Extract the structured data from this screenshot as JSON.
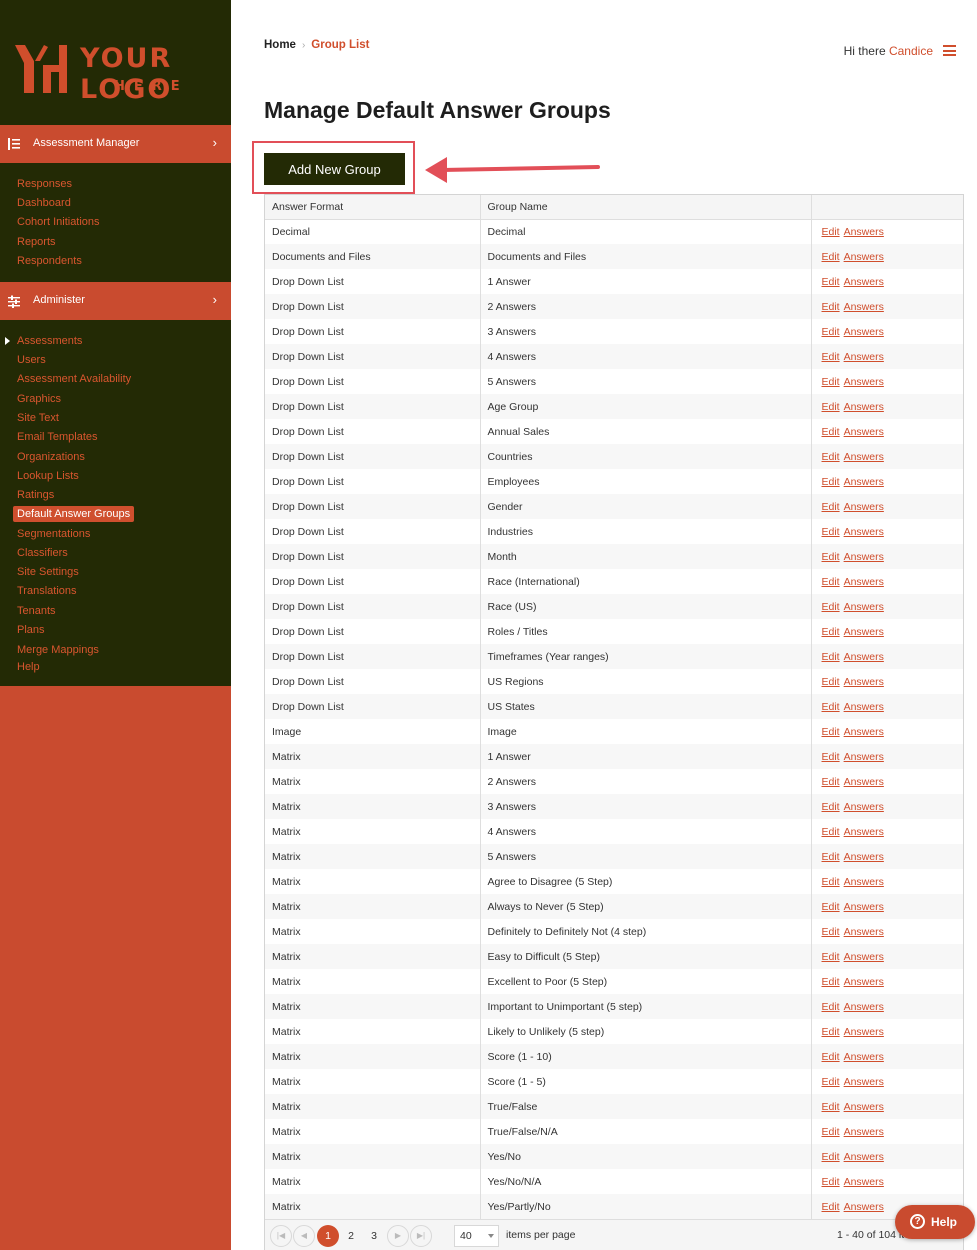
{
  "brand": {
    "logo_main": "YOUR LOGO",
    "logo_sub": "HERE",
    "accent": "#d04e2c",
    "dark": "#232a05"
  },
  "sidebar": {
    "sections": [
      {
        "label": "Assessment Manager",
        "icon": "list-icon",
        "items": [
          "Responses",
          "Dashboard",
          "Cohort Initiations",
          "Reports",
          "Respondents"
        ]
      },
      {
        "label": "Administer",
        "icon": "sliders-icon",
        "items": [
          "Assessments",
          "Users",
          "Assessment Availability",
          "Graphics",
          "Site Text",
          "Email Templates",
          "Organizations",
          "Lookup Lists",
          "Ratings",
          "Default Answer Groups",
          "Segmentations",
          "Classifiers",
          "Site Settings",
          "Translations",
          "Tenants",
          "Plans",
          "Merge Mappings",
          "Help"
        ]
      }
    ],
    "active_item": "Default Answer Groups"
  },
  "header": {
    "breadcrumb": {
      "home": "Home",
      "separator": "›",
      "current": "Group List"
    },
    "greeting": "Hi there",
    "user_name": "Candice"
  },
  "main": {
    "title": "Manage Default Answer Groups",
    "add_button": "Add New Group",
    "table": {
      "columns": [
        "Answer Format",
        "Group Name",
        ""
      ],
      "actions": [
        "Edit",
        "Answers"
      ],
      "rows": [
        [
          "Decimal",
          "Decimal"
        ],
        [
          "Documents and Files",
          "Documents and Files"
        ],
        [
          "Drop Down List",
          "1 Answer"
        ],
        [
          "Drop Down List",
          "2 Answers"
        ],
        [
          "Drop Down List",
          "3 Answers"
        ],
        [
          "Drop Down List",
          "4 Answers"
        ],
        [
          "Drop Down List",
          "5 Answers"
        ],
        [
          "Drop Down List",
          "Age Group"
        ],
        [
          "Drop Down List",
          "Annual Sales"
        ],
        [
          "Drop Down List",
          "Countries"
        ],
        [
          "Drop Down List",
          "Employees"
        ],
        [
          "Drop Down List",
          "Gender"
        ],
        [
          "Drop Down List",
          "Industries"
        ],
        [
          "Drop Down List",
          "Month"
        ],
        [
          "Drop Down List",
          "Race (International)"
        ],
        [
          "Drop Down List",
          "Race (US)"
        ],
        [
          "Drop Down List",
          "Roles / Titles"
        ],
        [
          "Drop Down List",
          "Timeframes (Year ranges)"
        ],
        [
          "Drop Down List",
          "US Regions"
        ],
        [
          "Drop Down List",
          "US States"
        ],
        [
          "Image",
          "Image"
        ],
        [
          "Matrix",
          "1 Answer"
        ],
        [
          "Matrix",
          "2 Answers"
        ],
        [
          "Matrix",
          "3 Answers"
        ],
        [
          "Matrix",
          "4 Answers"
        ],
        [
          "Matrix",
          "5 Answers"
        ],
        [
          "Matrix",
          "Agree to Disagree (5 Step)"
        ],
        [
          "Matrix",
          "Always to Never (5 Step)"
        ],
        [
          "Matrix",
          "Definitely to Definitely Not (4 step)"
        ],
        [
          "Matrix",
          "Easy to Difficult (5 Step)"
        ],
        [
          "Matrix",
          "Excellent to Poor (5 Step)"
        ],
        [
          "Matrix",
          "Important to Unimportant (5 step)"
        ],
        [
          "Matrix",
          "Likely to Unlikely (5 step)"
        ],
        [
          "Matrix",
          "Score (1 - 10)"
        ],
        [
          "Matrix",
          "Score (1 - 5)"
        ],
        [
          "Matrix",
          "True/False"
        ],
        [
          "Matrix",
          "True/False/N/A"
        ],
        [
          "Matrix",
          "Yes/No"
        ],
        [
          "Matrix",
          "Yes/No/N/A"
        ],
        [
          "Matrix",
          "Yes/Partly/No"
        ]
      ]
    },
    "pager": {
      "pages": [
        "1",
        "2",
        "3"
      ],
      "current_page": "1",
      "per_page": "40",
      "per_page_label": "items per page",
      "info": "1 - 40 of 104 items"
    }
  },
  "help": {
    "label": "Help"
  }
}
